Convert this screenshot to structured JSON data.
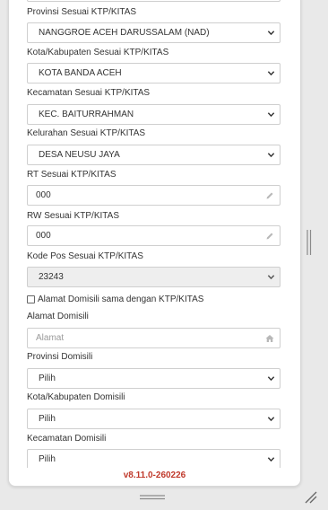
{
  "form": {
    "provinsi_ktp": {
      "label": "Provinsi Sesuai KTP/KITAS",
      "value": "NANGGROE ACEH DARUSSALAM (NAD)"
    },
    "kota_ktp": {
      "label": "Kota/Kabupaten Sesuai KTP/KITAS",
      "value": "KOTA BANDA ACEH"
    },
    "kecamatan_ktp": {
      "label": "Kecamatan Sesuai KTP/KITAS",
      "value": "KEC. BAITURRAHMAN"
    },
    "kelurahan_ktp": {
      "label": "Kelurahan Sesuai KTP/KITAS",
      "value": "DESA NEUSU JAYA"
    },
    "rt_ktp": {
      "label": "RT Sesuai KTP/KITAS",
      "value": "000"
    },
    "rw_ktp": {
      "label": "RW Sesuai KTP/KITAS",
      "value": "000"
    },
    "kodepos_ktp": {
      "label": "Kode Pos Sesuai KTP/KITAS",
      "value": "23243"
    },
    "same_address": {
      "label": "Alamat Domisili sama dengan KTP/KITAS",
      "checked": false
    },
    "alamat_domisili": {
      "label": "Alamat Domisili",
      "placeholder": "Alamat"
    },
    "provinsi_domisili": {
      "label": "Provinsi Domisili",
      "value": "Pilih"
    },
    "kota_domisili": {
      "label": "Kota/Kabupaten Domisili",
      "value": "Pilih"
    },
    "kecamatan_domisili": {
      "label": "Kecamatan Domisili",
      "value": "Pilih"
    }
  },
  "footer": {
    "version": "v8.11.0-260226"
  },
  "icons": {
    "select": "chevron-down-icon",
    "edit": "pencil-icon",
    "address": "home-icon"
  },
  "colors": {
    "version_text": "#c0392b",
    "border": "#cfcfcf",
    "disabled_bg": "#eeeeee"
  }
}
